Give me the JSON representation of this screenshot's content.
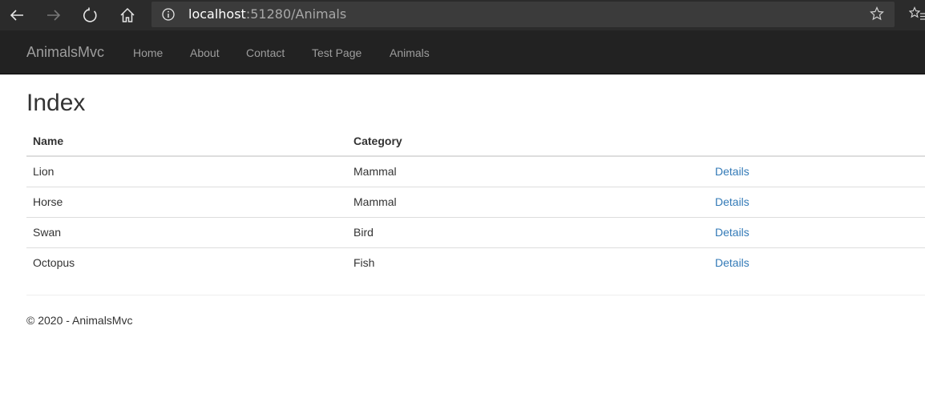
{
  "browser": {
    "url_host": "localhost",
    "url_rest": ":51280/Animals",
    "icons": [
      "back-icon",
      "forward-icon",
      "refresh-icon",
      "home-icon",
      "info-icon",
      "star-icon",
      "favorites-icon"
    ]
  },
  "navbar": {
    "brand": "AnimalsMvc",
    "links": [
      "Home",
      "About",
      "Contact",
      "Test Page",
      "Animals"
    ]
  },
  "page": {
    "title": "Index"
  },
  "table": {
    "headers": {
      "name": "Name",
      "category": "Category"
    },
    "rows": [
      {
        "name": "Lion",
        "category": "Mammal",
        "action": "Details"
      },
      {
        "name": "Horse",
        "category": "Mammal",
        "action": "Details"
      },
      {
        "name": "Swan",
        "category": "Bird",
        "action": "Details"
      },
      {
        "name": "Octopus",
        "category": "Fish",
        "action": "Details"
      }
    ]
  },
  "footer": {
    "text": "© 2020 - AnimalsMvc"
  },
  "colors": {
    "navbar_bg": "#222222",
    "link": "#337ab7",
    "browser_bg": "#2b2b2b"
  }
}
